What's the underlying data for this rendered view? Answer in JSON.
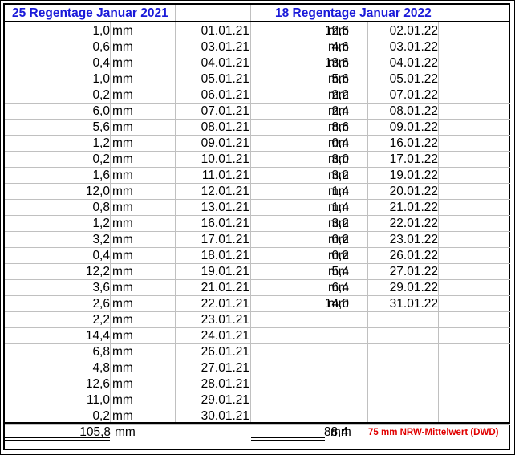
{
  "headers": {
    "col2021": "25 Regentage Januar 2021",
    "col2022": "18 Regentage Januar 2022"
  },
  "unit": "mm",
  "rows2021": [
    {
      "value": "1,0",
      "date": "01.01.21"
    },
    {
      "value": "0,6",
      "date": "03.01.21"
    },
    {
      "value": "0,4",
      "date": "04.01.21"
    },
    {
      "value": "1,0",
      "date": "05.01.21"
    },
    {
      "value": "0,2",
      "date": "06.01.21"
    },
    {
      "value": "6,0",
      "date": "07.01.21"
    },
    {
      "value": "5,6",
      "date": "08.01.21"
    },
    {
      "value": "1,2",
      "date": "09.01.21"
    },
    {
      "value": "0,2",
      "date": "10.01.21"
    },
    {
      "value": "1,6",
      "date": "11.01.21"
    },
    {
      "value": "12,0",
      "date": "12.01.21"
    },
    {
      "value": "0,8",
      "date": "13.01.21"
    },
    {
      "value": "1,2",
      "date": "16.01.21"
    },
    {
      "value": "3,2",
      "date": "17.01.21"
    },
    {
      "value": "0,4",
      "date": "18.01.21"
    },
    {
      "value": "12,2",
      "date": "19.01.21"
    },
    {
      "value": "3,6",
      "date": "21.01.21"
    },
    {
      "value": "2,6",
      "date": "22.01.21"
    },
    {
      "value": "2,2",
      "date": "23.01.21"
    },
    {
      "value": "14,4",
      "date": "24.01.21"
    },
    {
      "value": "6,8",
      "date": "26.01.21"
    },
    {
      "value": "4,8",
      "date": "27.01.21"
    },
    {
      "value": "12,6",
      "date": "28.01.21"
    },
    {
      "value": "11,0",
      "date": "29.01.21"
    },
    {
      "value": "0,2",
      "date": "30.01.21"
    }
  ],
  "rows2022": [
    {
      "value": "12,6",
      "date": "02.01.22"
    },
    {
      "value": "4,6",
      "date": "03.01.22"
    },
    {
      "value": "13,6",
      "date": "04.01.22"
    },
    {
      "value": "5,6",
      "date": "05.01.22"
    },
    {
      "value": "2,2",
      "date": "07.01.22"
    },
    {
      "value": "2,4",
      "date": "08.01.22"
    },
    {
      "value": "8,6",
      "date": "09.01.22"
    },
    {
      "value": "0,4",
      "date": "16.01.22"
    },
    {
      "value": "3,0",
      "date": "17.01.22"
    },
    {
      "value": "3,2",
      "date": "19.01.22"
    },
    {
      "value": "1,4",
      "date": "20.01.22"
    },
    {
      "value": "1,4",
      "date": "21.01.22"
    },
    {
      "value": "3,2",
      "date": "22.01.22"
    },
    {
      "value": "0,2",
      "date": "23.01.22"
    },
    {
      "value": "0,2",
      "date": "26.01.22"
    },
    {
      "value": "5,4",
      "date": "27.01.22"
    },
    {
      "value": "6,4",
      "date": "29.01.22"
    },
    {
      "value": "14,0",
      "date": "31.01.22"
    }
  ],
  "totals": {
    "total2021": "105,8",
    "total2022": "88,4",
    "note": "75 mm NRW-Mittelwert (DWD)"
  }
}
